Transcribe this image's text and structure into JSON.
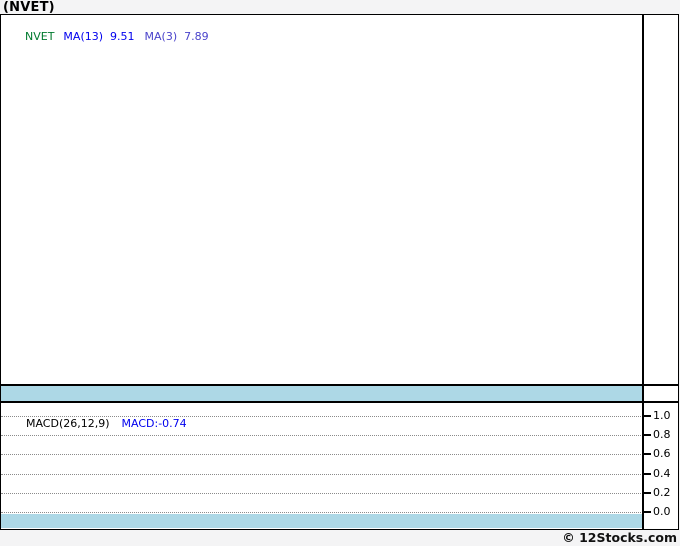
{
  "page": {
    "title": "(NVET)",
    "background": "#f4f4f5",
    "footer_copyright": "© 12Stocks.com"
  },
  "price_panel": {
    "legend": {
      "ticker": "NVET",
      "ma13_label": "MA(13)",
      "ma13_value": "9.51",
      "ma3_label": "MA(3)",
      "ma3_value": "7.89"
    }
  },
  "macd_panel": {
    "label": "MACD(26,12,9)",
    "value": "MACD:-0.74",
    "axis_ticks": [
      "1.0",
      "0.8",
      "0.6",
      "0.4",
      "0.2",
      "0.0"
    ]
  },
  "colors": {
    "ticker_green": "#007a2e",
    "ma13_blue": "#0000ee",
    "ma3_purple": "#4a43cb",
    "macd_value_blue": "#0000ee",
    "band_lightblue": "#add8e6",
    "gridline_gray": "#8b8b8b",
    "border_black": "#000000"
  },
  "chart_data": [
    {
      "type": "line",
      "panel": "price",
      "title": "(NVET)",
      "legend": [
        "NVET",
        "MA(13) 9.51",
        "MA(3) 7.89"
      ],
      "legend_position": "top-left",
      "indicators": {
        "MA13": 9.51,
        "MA3": 7.89
      },
      "series": [],
      "note": "price pane is blank; solid light-blue band spans the bottom edge"
    },
    {
      "type": "line",
      "panel": "MACD(26,12,9)",
      "legend": [
        "MACD:-0.74"
      ],
      "legend_position": "top-left",
      "indicators": {
        "MACD": -0.74
      },
      "ylim": [
        0.0,
        1.0
      ],
      "yticks": [
        1.0,
        0.8,
        0.6,
        0.4,
        0.2,
        0.0
      ],
      "grid": true,
      "series": [],
      "note": "MACD pane is blank; solid light-blue band spans the bottom edge"
    }
  ]
}
